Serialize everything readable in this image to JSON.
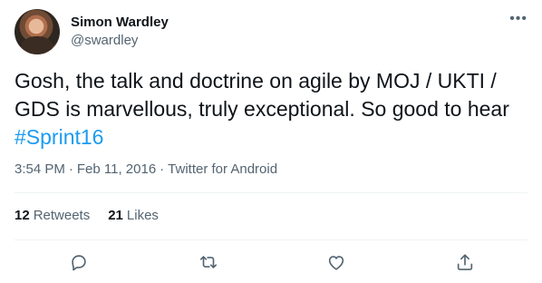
{
  "user": {
    "display_name": "Simon Wardley",
    "handle": "@swardley"
  },
  "more_icon": "more-horizontal-icon",
  "tweet": {
    "text_main": "Gosh, the talk and doctrine on agile by MOJ / UKTI / GDS is marvellous, truly exceptional. So good to hear ",
    "hashtag": "#Sprint16"
  },
  "meta": {
    "time": "3:54 PM",
    "sep1": "·",
    "date": "Feb 11, 2016",
    "sep2": "·",
    "source": "Twitter for Android"
  },
  "stats": {
    "retweets_count": "12",
    "retweets_label": "Retweets",
    "likes_count": "21",
    "likes_label": "Likes"
  },
  "actions": [
    "reply-icon",
    "retweet-icon",
    "like-icon",
    "share-icon"
  ],
  "colors": {
    "text": "#0f1419",
    "muted": "#536471",
    "link": "#1d9bf0",
    "divider": "#eff3f4"
  }
}
